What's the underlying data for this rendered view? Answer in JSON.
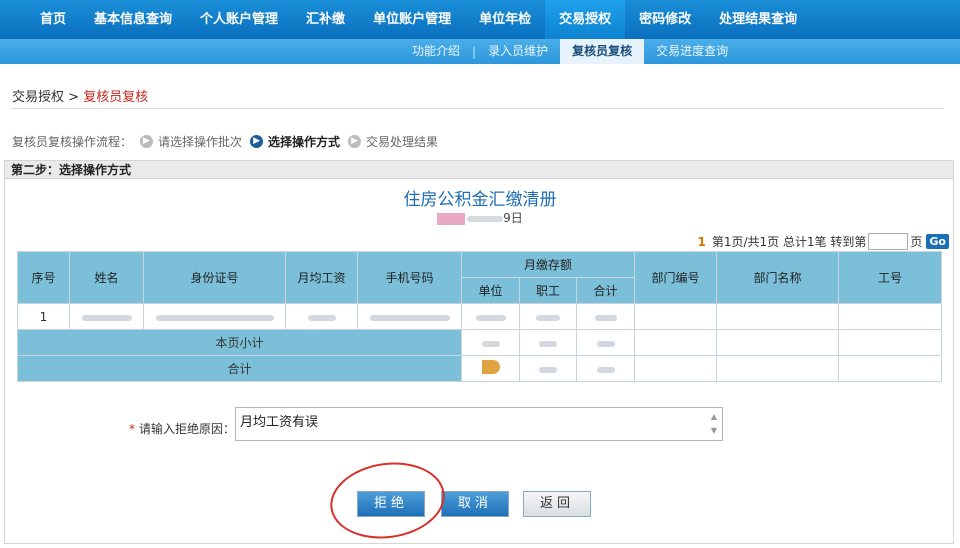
{
  "topnav": {
    "items": [
      "首页",
      "基本信息查询",
      "个人账户管理",
      "汇补缴",
      "单位账户管理",
      "单位年检",
      "交易授权",
      "密码修改",
      "处理结果查询"
    ],
    "active_index": 6
  },
  "subnav": {
    "items": [
      "功能介绍",
      "录入员维护",
      "复核员复核",
      "交易进度查询"
    ],
    "separator": "|",
    "active_index": 2
  },
  "breadcrumb": {
    "parent": "交易授权",
    "separator": ">",
    "current": "复核员复核"
  },
  "flow": {
    "label": "复核员复核操作流程：",
    "steps": [
      {
        "label": "请选择操作批次",
        "done": false
      },
      {
        "label": "选择操作方式",
        "done": true
      },
      {
        "label": "交易处理结果",
        "done": false
      }
    ]
  },
  "panel": {
    "title": "第二步：选择操作方式"
  },
  "document": {
    "title": "住房公积金汇缴清册",
    "date_suffix": "9日"
  },
  "pager": {
    "page_num": "1",
    "info": "第1页/共1页 总计1笔 转到第",
    "page_unit": "页",
    "go_label": "Go",
    "input_value": ""
  },
  "table": {
    "headers": {
      "seq": "序号",
      "name": "姓名",
      "id": "身份证号",
      "salary": "月均工资",
      "phone": "手机号码",
      "monthly": "月缴存额",
      "unit": "单位",
      "staff": "职工",
      "total": "合计",
      "dept_no": "部门编号",
      "dept_name": "部门名称",
      "emp_no": "工号"
    },
    "rows": [
      {
        "seq": "1"
      }
    ],
    "subtotal_label": "本页小计",
    "total_label": "合计"
  },
  "reason": {
    "required_mark": "*",
    "label": "请输入拒绝原因：",
    "value": "月均工资有误"
  },
  "buttons": {
    "reject": "拒绝",
    "cancel": "取消",
    "back": "返回"
  },
  "colors": {
    "nav": "#0a6fbe",
    "header": "#7bbfd8",
    "accent": "#c7251a",
    "annotation": "#d8302a"
  }
}
